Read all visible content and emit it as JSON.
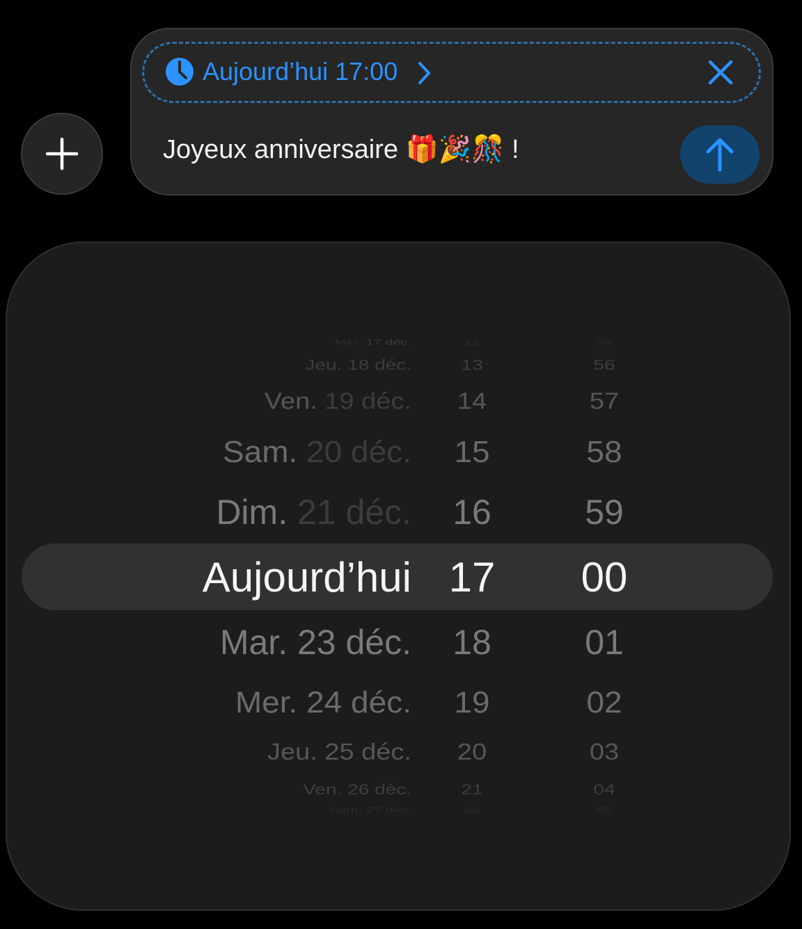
{
  "composer": {
    "schedule_label": "Aujourd’hui 17:00",
    "message": "Joyeux anniversaire 🎁🎉🎊 !",
    "icons": {
      "clock": "clock-icon",
      "chevron": "chevron-right-icon",
      "close": "close-icon",
      "send": "arrow-up-icon",
      "add": "plus-icon"
    },
    "accent_color": "#2b92ff",
    "send_bg": "#11436d"
  },
  "picker": {
    "rows": [
      {
        "weekday": "Mer.",
        "date": "17 déc.",
        "hour": "12",
        "minute": "55"
      },
      {
        "weekday": "Jeu.",
        "date": "18 déc.",
        "hour": "13",
        "minute": "56"
      },
      {
        "weekday": "Ven.",
        "date": "19 déc.",
        "hour": "14",
        "minute": "57"
      },
      {
        "weekday": "Sam.",
        "date": "20 déc.",
        "hour": "15",
        "minute": "58"
      },
      {
        "weekday": "Dim.",
        "date": "21 déc.",
        "hour": "16",
        "minute": "59"
      },
      {
        "weekday": "Aujourd’hui",
        "date": "",
        "hour": "17",
        "minute": "00"
      },
      {
        "weekday": "Mar.",
        "date": "23 déc.",
        "hour": "18",
        "minute": "01"
      },
      {
        "weekday": "Mer.",
        "date": "24 déc.",
        "hour": "19",
        "minute": "02"
      },
      {
        "weekday": "Jeu.",
        "date": "25 déc.",
        "hour": "20",
        "minute": "03"
      },
      {
        "weekday": "Ven.",
        "date": "26 déc.",
        "hour": "21",
        "minute": "04"
      },
      {
        "weekday": "Sam.",
        "date": "27 déc.",
        "hour": "22",
        "minute": "05"
      }
    ],
    "selected_index": 5
  }
}
